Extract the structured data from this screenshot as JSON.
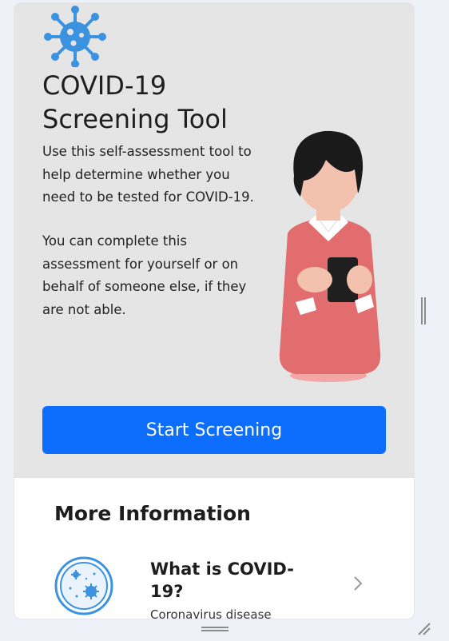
{
  "hero": {
    "title": "COVID-19 Screening Tool",
    "paragraph_1": "Use this self-assessment tool to help determine whether you need to be tested for COVID-19.",
    "paragraph_2": "You can complete this assessment for yourself or on behalf of someone else, if they are not able.",
    "start_button_label": "Start Screening"
  },
  "more_info": {
    "heading": "More Information",
    "cards": [
      {
        "title": "What is COVID-19?",
        "subtitle": "Coronavirus disease",
        "icon": "virus-petri-icon"
      }
    ]
  },
  "colors": {
    "hero_bg": "#e5e5e5",
    "primary": "#0d6efd",
    "virus_blue": "#3b93e0"
  }
}
